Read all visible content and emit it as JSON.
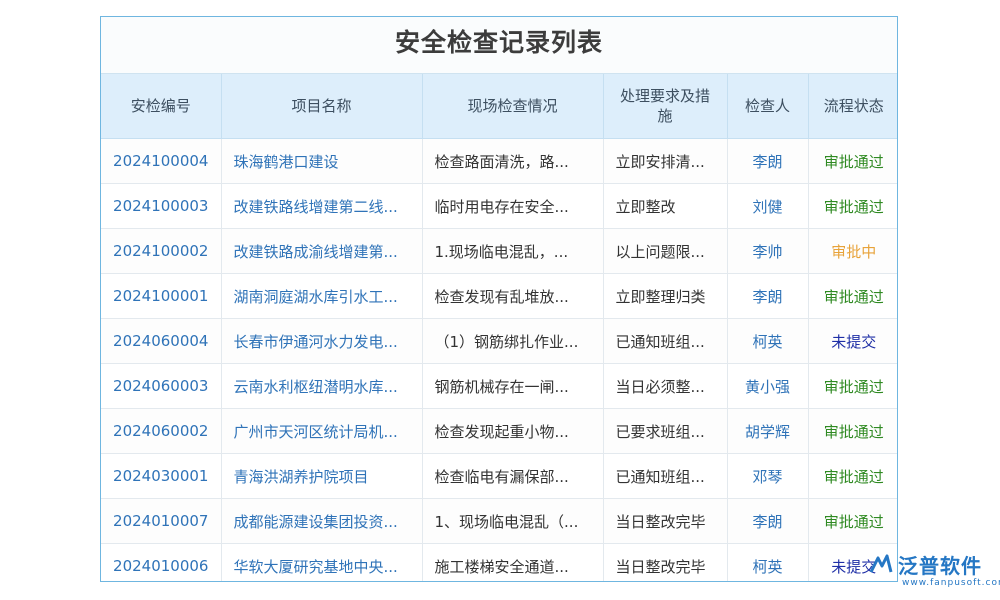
{
  "page_title": "安全检查记录列表",
  "columns": [
    "安检编号",
    "项目名称",
    "现场检查情况",
    "处理要求及措施",
    "检查人",
    "流程状态"
  ],
  "rows": [
    {
      "id": "2024100004",
      "project": "珠海鹤港口建设",
      "inspection": "检查路面清洗，路...",
      "measures": "立即安排清...",
      "inspector": "李朗",
      "status": "审批通过",
      "status_type": "approved"
    },
    {
      "id": "2024100003",
      "project": "改建铁路线增建第二线...",
      "inspection": "临时用电存在安全...",
      "measures": "立即整改",
      "inspector": "刘健",
      "status": "审批通过",
      "status_type": "approved"
    },
    {
      "id": "2024100002",
      "project": "改建铁路成渝线增建第...",
      "inspection": "1.现场临电混乱，...",
      "measures": "以上问题限...",
      "inspector": "李帅",
      "status": "审批中",
      "status_type": "pending"
    },
    {
      "id": "2024100001",
      "project": "湖南洞庭湖水库引水工...",
      "inspection": "检查发现有乱堆放...",
      "measures": "立即整理归类",
      "inspector": "李朗",
      "status": "审批通过",
      "status_type": "approved"
    },
    {
      "id": "2024060004",
      "project": "长春市伊通河水力发电...",
      "inspection": "（1）钢筋绑扎作业...",
      "measures": "已通知班组...",
      "inspector": "柯英",
      "status": "未提交",
      "status_type": "unsubmitted"
    },
    {
      "id": "2024060003",
      "project": "云南水利枢纽潜明水库...",
      "inspection": "钢筋机械存在一闸...",
      "measures": "当日必须整...",
      "inspector": "黄小强",
      "status": "审批通过",
      "status_type": "approved"
    },
    {
      "id": "2024060002",
      "project": "广州市天河区统计局机...",
      "inspection": "检查发现起重小物...",
      "measures": "已要求班组...",
      "inspector": "胡学辉",
      "status": "审批通过",
      "status_type": "approved"
    },
    {
      "id": "2024030001",
      "project": "青海洪湖养护院项目",
      "inspection": "检查临电有漏保部...",
      "measures": "已通知班组...",
      "inspector": "邓琴",
      "status": "审批通过",
      "status_type": "approved"
    },
    {
      "id": "2024010007",
      "project": "成都能源建设集团投资...",
      "inspection": "1、现场临电混乱（...",
      "measures": "当日整改完毕",
      "inspector": "李朗",
      "status": "审批通过",
      "status_type": "approved"
    },
    {
      "id": "2024010006",
      "project": "华软大厦研究基地中央...",
      "inspection": "施工楼梯安全通道...",
      "measures": "当日整改完毕",
      "inspector": "柯英",
      "status": "未提交",
      "status_type": "unsubmitted"
    }
  ],
  "watermark": {
    "brand": "泛普软件",
    "url": "www.fanpusoft.com"
  },
  "colors": {
    "link": "#2f73b8",
    "approved": "#2f8a22",
    "pending": "#e8a33a",
    "unsubmitted": "#1f2fa6",
    "header_bg": "#ddeefb",
    "border": "#6fb6e0"
  }
}
